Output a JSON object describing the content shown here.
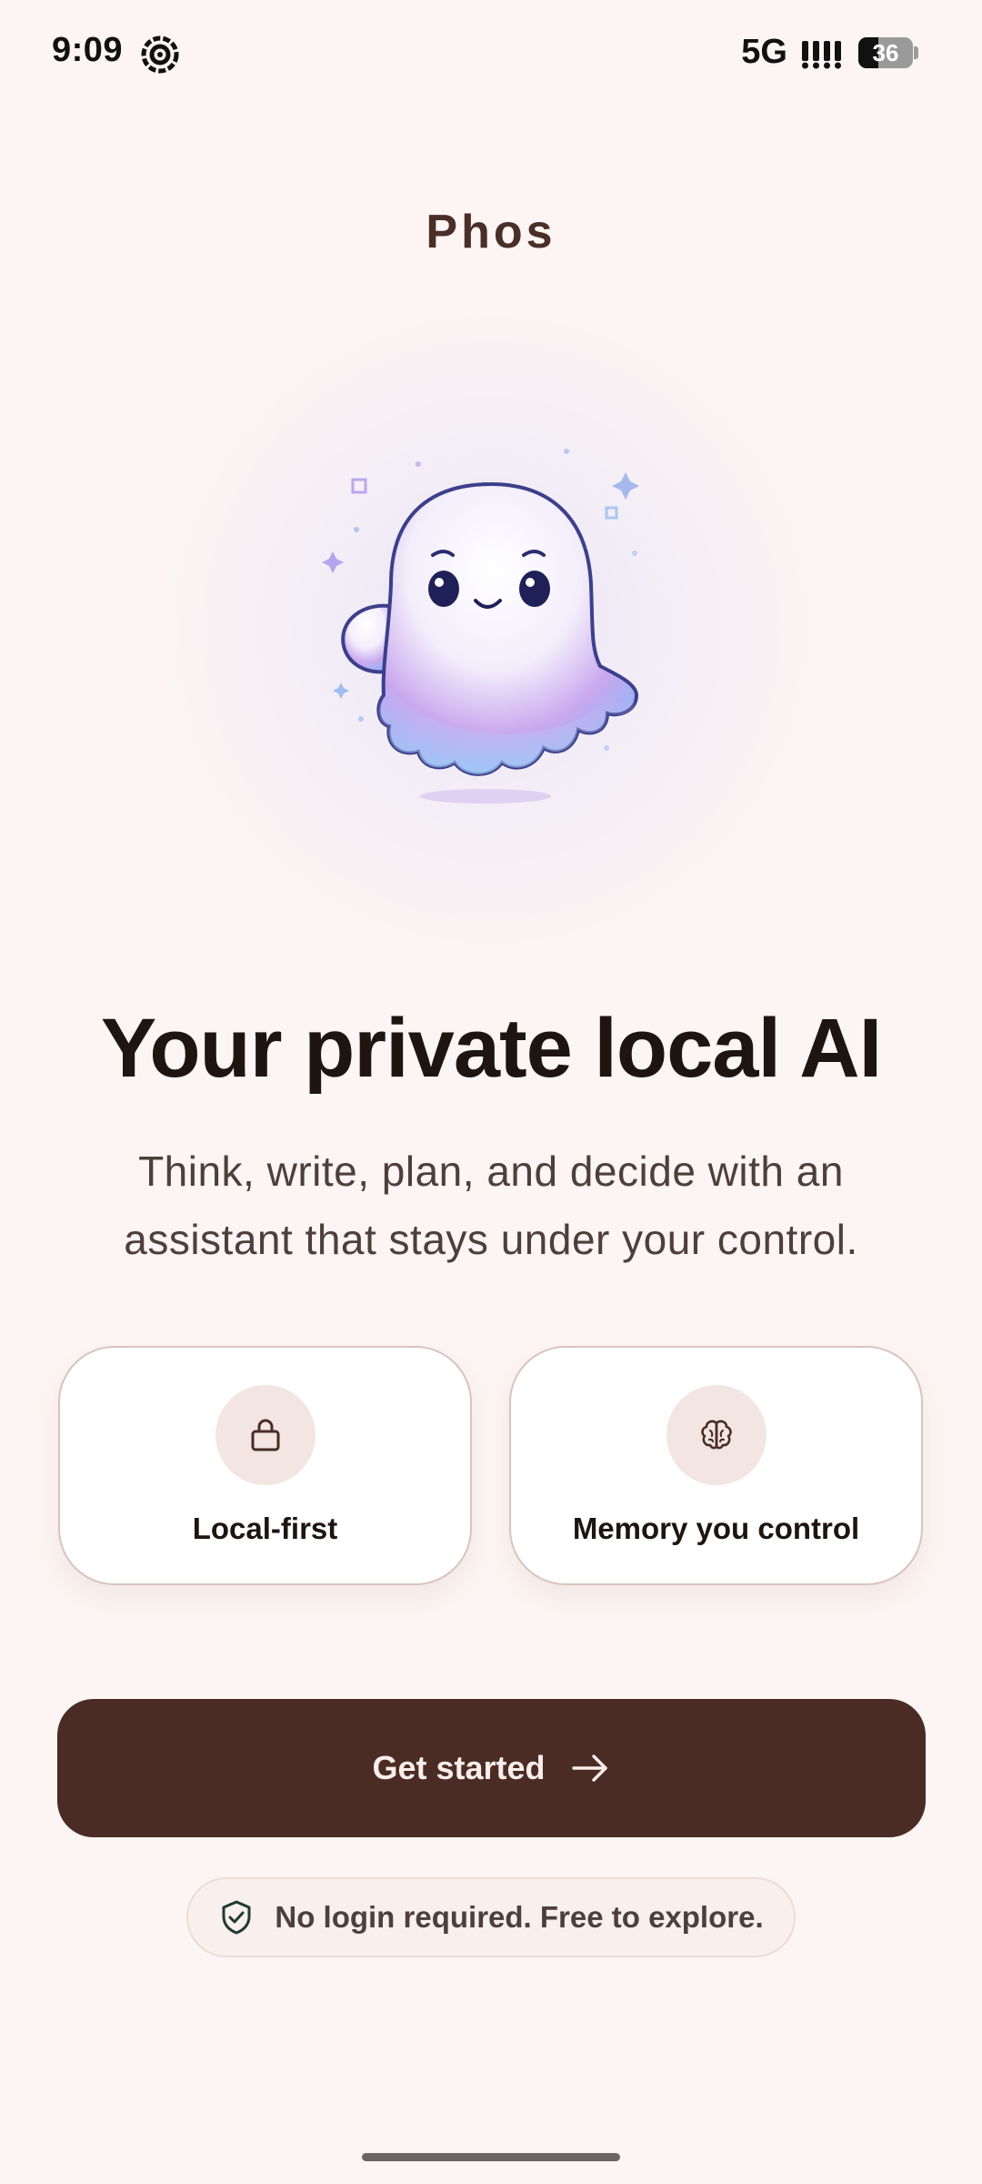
{
  "status_bar": {
    "time": "9:09",
    "network": "5G",
    "battery_level": "36",
    "battery_fraction": 0.36,
    "app_icon": "swirl-app-icon",
    "signal_icon": "signal-bars-icon"
  },
  "header": {
    "app_name": "Phos"
  },
  "mascot": {
    "name": "ghost-mascot-illustration"
  },
  "hero": {
    "headline": "Your private local AI",
    "subtitle": "Think, write, plan, and decide with an assistant that stays under your control."
  },
  "features": [
    {
      "label": "Local-first",
      "icon": "lock-icon"
    },
    {
      "label": "Memory you control",
      "icon": "brain-icon"
    }
  ],
  "cta": {
    "label": "Get started",
    "icon": "arrow-right-icon"
  },
  "note": {
    "text": "No login required. Free to explore.",
    "icon": "shield-check-icon"
  },
  "colors": {
    "background": "#fdf5f3",
    "primary": "#4a2c25",
    "card_border": "#d9c3bf",
    "icon_circle": "#f3e5e1"
  }
}
